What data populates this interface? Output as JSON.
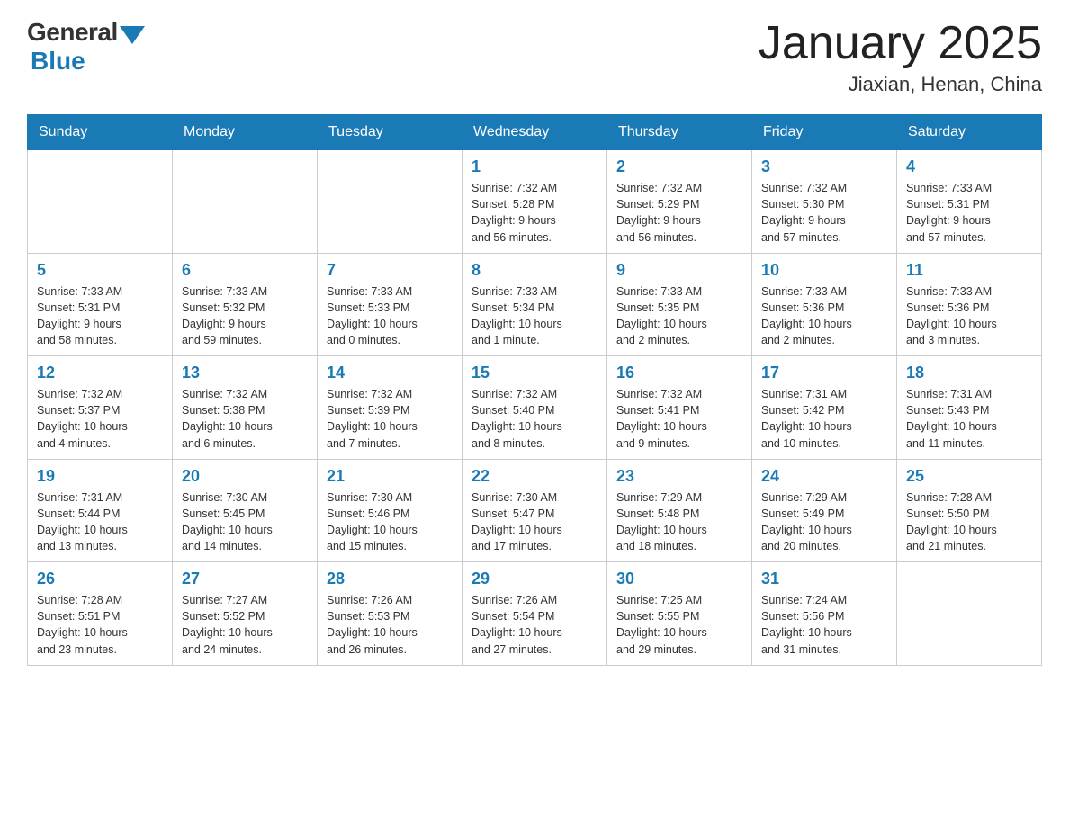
{
  "header": {
    "logo_general": "General",
    "logo_blue": "Blue",
    "title": "January 2025",
    "subtitle": "Jiaxian, Henan, China"
  },
  "days_of_week": [
    "Sunday",
    "Monday",
    "Tuesday",
    "Wednesday",
    "Thursday",
    "Friday",
    "Saturday"
  ],
  "weeks": [
    [
      {
        "day": "",
        "info": ""
      },
      {
        "day": "",
        "info": ""
      },
      {
        "day": "",
        "info": ""
      },
      {
        "day": "1",
        "info": "Sunrise: 7:32 AM\nSunset: 5:28 PM\nDaylight: 9 hours\nand 56 minutes."
      },
      {
        "day": "2",
        "info": "Sunrise: 7:32 AM\nSunset: 5:29 PM\nDaylight: 9 hours\nand 56 minutes."
      },
      {
        "day": "3",
        "info": "Sunrise: 7:32 AM\nSunset: 5:30 PM\nDaylight: 9 hours\nand 57 minutes."
      },
      {
        "day": "4",
        "info": "Sunrise: 7:33 AM\nSunset: 5:31 PM\nDaylight: 9 hours\nand 57 minutes."
      }
    ],
    [
      {
        "day": "5",
        "info": "Sunrise: 7:33 AM\nSunset: 5:31 PM\nDaylight: 9 hours\nand 58 minutes."
      },
      {
        "day": "6",
        "info": "Sunrise: 7:33 AM\nSunset: 5:32 PM\nDaylight: 9 hours\nand 59 minutes."
      },
      {
        "day": "7",
        "info": "Sunrise: 7:33 AM\nSunset: 5:33 PM\nDaylight: 10 hours\nand 0 minutes."
      },
      {
        "day": "8",
        "info": "Sunrise: 7:33 AM\nSunset: 5:34 PM\nDaylight: 10 hours\nand 1 minute."
      },
      {
        "day": "9",
        "info": "Sunrise: 7:33 AM\nSunset: 5:35 PM\nDaylight: 10 hours\nand 2 minutes."
      },
      {
        "day": "10",
        "info": "Sunrise: 7:33 AM\nSunset: 5:36 PM\nDaylight: 10 hours\nand 2 minutes."
      },
      {
        "day": "11",
        "info": "Sunrise: 7:33 AM\nSunset: 5:36 PM\nDaylight: 10 hours\nand 3 minutes."
      }
    ],
    [
      {
        "day": "12",
        "info": "Sunrise: 7:32 AM\nSunset: 5:37 PM\nDaylight: 10 hours\nand 4 minutes."
      },
      {
        "day": "13",
        "info": "Sunrise: 7:32 AM\nSunset: 5:38 PM\nDaylight: 10 hours\nand 6 minutes."
      },
      {
        "day": "14",
        "info": "Sunrise: 7:32 AM\nSunset: 5:39 PM\nDaylight: 10 hours\nand 7 minutes."
      },
      {
        "day": "15",
        "info": "Sunrise: 7:32 AM\nSunset: 5:40 PM\nDaylight: 10 hours\nand 8 minutes."
      },
      {
        "day": "16",
        "info": "Sunrise: 7:32 AM\nSunset: 5:41 PM\nDaylight: 10 hours\nand 9 minutes."
      },
      {
        "day": "17",
        "info": "Sunrise: 7:31 AM\nSunset: 5:42 PM\nDaylight: 10 hours\nand 10 minutes."
      },
      {
        "day": "18",
        "info": "Sunrise: 7:31 AM\nSunset: 5:43 PM\nDaylight: 10 hours\nand 11 minutes."
      }
    ],
    [
      {
        "day": "19",
        "info": "Sunrise: 7:31 AM\nSunset: 5:44 PM\nDaylight: 10 hours\nand 13 minutes."
      },
      {
        "day": "20",
        "info": "Sunrise: 7:30 AM\nSunset: 5:45 PM\nDaylight: 10 hours\nand 14 minutes."
      },
      {
        "day": "21",
        "info": "Sunrise: 7:30 AM\nSunset: 5:46 PM\nDaylight: 10 hours\nand 15 minutes."
      },
      {
        "day": "22",
        "info": "Sunrise: 7:30 AM\nSunset: 5:47 PM\nDaylight: 10 hours\nand 17 minutes."
      },
      {
        "day": "23",
        "info": "Sunrise: 7:29 AM\nSunset: 5:48 PM\nDaylight: 10 hours\nand 18 minutes."
      },
      {
        "day": "24",
        "info": "Sunrise: 7:29 AM\nSunset: 5:49 PM\nDaylight: 10 hours\nand 20 minutes."
      },
      {
        "day": "25",
        "info": "Sunrise: 7:28 AM\nSunset: 5:50 PM\nDaylight: 10 hours\nand 21 minutes."
      }
    ],
    [
      {
        "day": "26",
        "info": "Sunrise: 7:28 AM\nSunset: 5:51 PM\nDaylight: 10 hours\nand 23 minutes."
      },
      {
        "day": "27",
        "info": "Sunrise: 7:27 AM\nSunset: 5:52 PM\nDaylight: 10 hours\nand 24 minutes."
      },
      {
        "day": "28",
        "info": "Sunrise: 7:26 AM\nSunset: 5:53 PM\nDaylight: 10 hours\nand 26 minutes."
      },
      {
        "day": "29",
        "info": "Sunrise: 7:26 AM\nSunset: 5:54 PM\nDaylight: 10 hours\nand 27 minutes."
      },
      {
        "day": "30",
        "info": "Sunrise: 7:25 AM\nSunset: 5:55 PM\nDaylight: 10 hours\nand 29 minutes."
      },
      {
        "day": "31",
        "info": "Sunrise: 7:24 AM\nSunset: 5:56 PM\nDaylight: 10 hours\nand 31 minutes."
      },
      {
        "day": "",
        "info": ""
      }
    ]
  ]
}
